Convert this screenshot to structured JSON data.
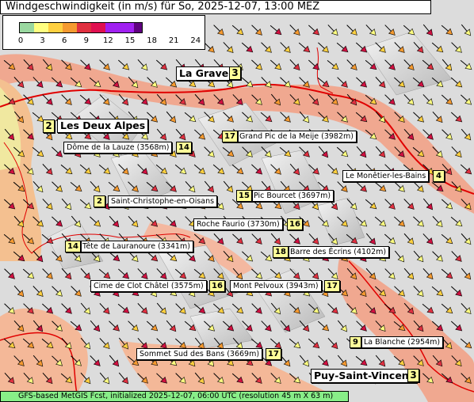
{
  "title": "Windgeschwindigkeit (in m/s) für So, 2025-12-07, 13:00 MEZ",
  "legend": {
    "ticks": [
      "0",
      "3",
      "6",
      "9",
      "12",
      "15",
      "18",
      "21",
      "24"
    ],
    "colors": [
      "#9ad8a0",
      "#ffff80",
      "#ffd040",
      "#f59a30",
      "#e03040",
      "#e01050",
      "#a020f0",
      "#a020f0",
      "#600080"
    ]
  },
  "locations": [
    {
      "name": "La Grave",
      "value": "3",
      "big": true
    },
    {
      "name": "Les Deux Alpes",
      "value": "2",
      "big": true
    },
    {
      "name": "Dôme de la Lauze (3568m)",
      "value": "14"
    },
    {
      "name": "Grand Pic de la Meije (3982m)",
      "value": "17"
    },
    {
      "name": "Le Monêtier-les-Bains",
      "value": "4"
    },
    {
      "name": "Saint-Christophe-en-Oisans",
      "value": "2"
    },
    {
      "name": "Pic Bourcet (3697m)",
      "value": "15"
    },
    {
      "name": "Roche Faurio (3730m)",
      "value": "16"
    },
    {
      "name": "Tête de Lauranoure (3341m)",
      "value": "14"
    },
    {
      "name": "Barre des Écrins (4102m)",
      "value": "18"
    },
    {
      "name": "Cime de Clot Châtel (3575m)",
      "value": "16"
    },
    {
      "name": "Mont Pelvoux (3943m)",
      "value": "17"
    },
    {
      "name": "La Blanche (2954m)",
      "value": "9"
    },
    {
      "name": "Sommet Sud des Bans (3669m)",
      "value": "17"
    },
    {
      "name": "Puy-Saint-Vincent",
      "value": "3",
      "big": true
    }
  ],
  "footer": "GFS-based MetGIS Fcst, initialized 2025-12-07, 06:00 UTC  (resolution 45 m X 63 m)"
}
